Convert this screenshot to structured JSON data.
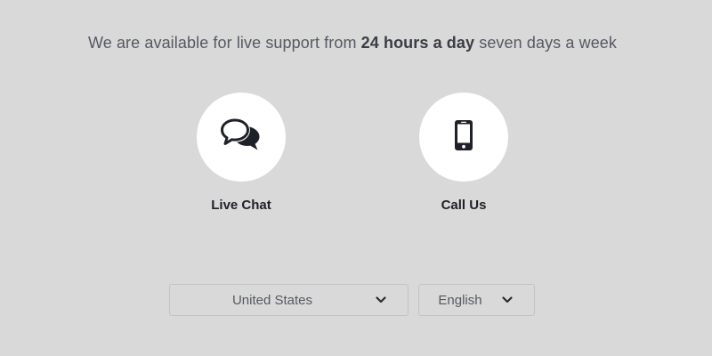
{
  "support": {
    "text_before": "We are available for live support from ",
    "text_bold": "24 hours a day",
    "text_after": " seven days a week"
  },
  "options": {
    "chat": {
      "label": "Live Chat",
      "icon": "chat-bubbles-icon"
    },
    "call": {
      "label": "Call Us",
      "icon": "mobile-phone-icon"
    }
  },
  "selectors": {
    "country": {
      "value": "United States",
      "icon": "chevron-down-icon"
    },
    "language": {
      "value": "English",
      "icon": "chevron-down-icon"
    }
  },
  "colors": {
    "background": "#d9d9d9",
    "circle": "#ffffff",
    "icon": "#1f2128"
  }
}
